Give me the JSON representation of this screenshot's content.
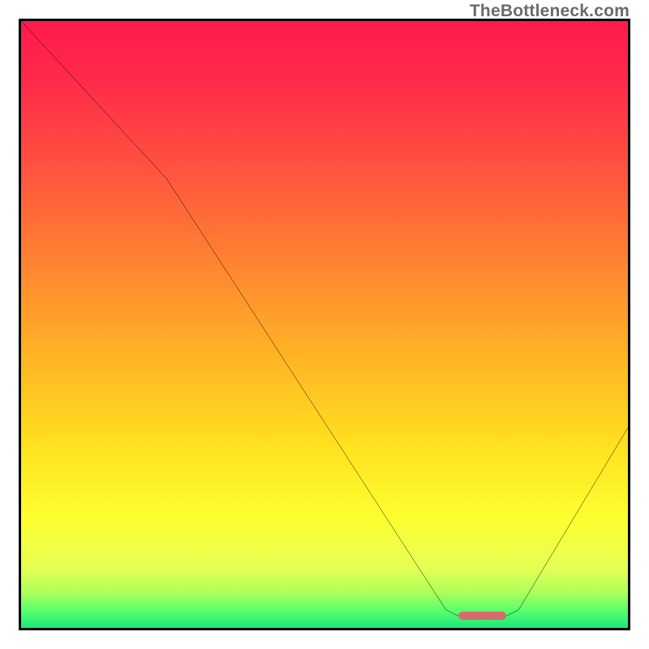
{
  "watermark": "TheBottleneck.com",
  "chart_data": {
    "type": "line",
    "title": "",
    "xlabel": "",
    "ylabel": "",
    "xlim": [
      0,
      100
    ],
    "ylim": [
      0,
      100
    ],
    "grid": false,
    "legend": false,
    "curve_points": [
      {
        "x": 0,
        "y": 100
      },
      {
        "x": 24,
        "y": 74
      },
      {
        "x": 70,
        "y": 3
      },
      {
        "x": 72,
        "y": 2
      },
      {
        "x": 80,
        "y": 2
      },
      {
        "x": 82,
        "y": 3
      },
      {
        "x": 100,
        "y": 33
      }
    ],
    "flat_segment": {
      "x_start": 72,
      "x_end": 80,
      "y": 2,
      "color": "#d66b6b"
    },
    "gradient_stops": [
      {
        "pct": 0,
        "color": "#ff1a4d"
      },
      {
        "pct": 10,
        "color": "#ff2b4a"
      },
      {
        "pct": 25,
        "color": "#ff553e"
      },
      {
        "pct": 40,
        "color": "#ff8431"
      },
      {
        "pct": 55,
        "color": "#ffb324"
      },
      {
        "pct": 70,
        "color": "#ffe11f"
      },
      {
        "pct": 82,
        "color": "#fdff30"
      },
      {
        "pct": 90,
        "color": "#e6ff55"
      },
      {
        "pct": 94,
        "color": "#b0ff5a"
      },
      {
        "pct": 97,
        "color": "#5eff6c"
      },
      {
        "pct": 100,
        "color": "#19e87a"
      }
    ]
  }
}
